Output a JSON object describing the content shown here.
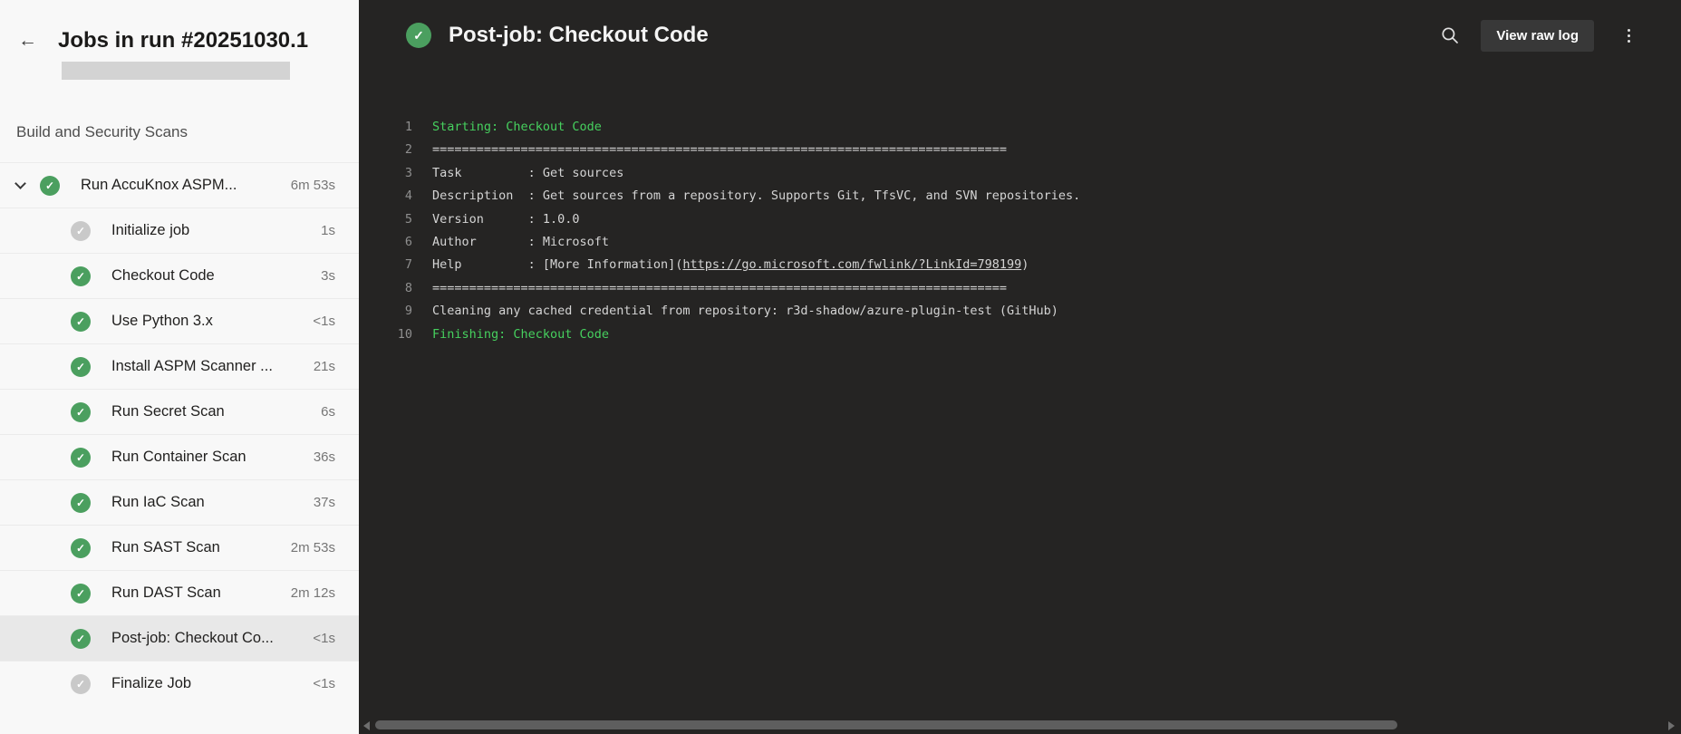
{
  "colors": {
    "success_green": "#4b9f5f",
    "pending_gray": "#c9c9c9",
    "panel_bg": "#252423",
    "log_green": "#46d05e",
    "log_text": "#d4d4d4",
    "line_num": "#8f8f8f",
    "sidebar_bg": "#f8f8f8",
    "selected_row": "#e8e8e8",
    "duration_gray": "#767676",
    "button_bg": "#383838"
  },
  "sidebar": {
    "back_icon": "left-arrow",
    "title": "Jobs in run #20251030.1",
    "section": "Build and Security Scans",
    "jobs": [
      {
        "label": "Run AccuKnox ASPM...",
        "duration": "6m 53s",
        "status": "success",
        "parent": true,
        "selected": false
      },
      {
        "label": "Initialize job",
        "duration": "1s",
        "status": "pending",
        "parent": false,
        "selected": false
      },
      {
        "label": "Checkout Code",
        "duration": "3s",
        "status": "success",
        "parent": false,
        "selected": false
      },
      {
        "label": "Use Python 3.x",
        "duration": "<1s",
        "status": "success",
        "parent": false,
        "selected": false
      },
      {
        "label": "Install ASPM Scanner ...",
        "duration": "21s",
        "status": "success",
        "parent": false,
        "selected": false
      },
      {
        "label": "Run Secret Scan",
        "duration": "6s",
        "status": "success",
        "parent": false,
        "selected": false
      },
      {
        "label": "Run Container Scan",
        "duration": "36s",
        "status": "success",
        "parent": false,
        "selected": false
      },
      {
        "label": "Run IaC Scan",
        "duration": "37s",
        "status": "success",
        "parent": false,
        "selected": false
      },
      {
        "label": "Run SAST Scan",
        "duration": "2m 53s",
        "status": "success",
        "parent": false,
        "selected": false
      },
      {
        "label": "Run DAST Scan",
        "duration": "2m 12s",
        "status": "success",
        "parent": false,
        "selected": false
      },
      {
        "label": "Post-job: Checkout Co...",
        "duration": "<1s",
        "status": "success",
        "parent": false,
        "selected": true
      },
      {
        "label": "Finalize Job",
        "duration": "<1s",
        "status": "pending",
        "parent": false,
        "selected": false
      }
    ]
  },
  "main": {
    "status": "success",
    "title": "Post-job: Checkout Code",
    "toolbar": {
      "search_icon": "magnifier",
      "view_raw_log_label": "View raw log",
      "more_icon": "kebab-vertical"
    },
    "log": {
      "lines": [
        {
          "num": "1",
          "segments": [
            {
              "text": "Starting: Checkout Code",
              "style": "section"
            }
          ]
        },
        {
          "num": "2",
          "segments": [
            {
              "text": "==============================================================================",
              "style": "plain"
            }
          ]
        },
        {
          "num": "3",
          "segments": [
            {
              "text": "Task         : Get sources",
              "style": "plain"
            }
          ]
        },
        {
          "num": "4",
          "segments": [
            {
              "text": "Description  : Get sources from a repository. Supports Git, TfsVC, and SVN repositories.",
              "style": "plain"
            }
          ]
        },
        {
          "num": "5",
          "segments": [
            {
              "text": "Version      : 1.0.0",
              "style": "plain"
            }
          ]
        },
        {
          "num": "6",
          "segments": [
            {
              "text": "Author       : Microsoft",
              "style": "plain"
            }
          ]
        },
        {
          "num": "7",
          "segments": [
            {
              "text": "Help         : [More Information](",
              "style": "plain"
            },
            {
              "text": "https://go.microsoft.com/fwlink/?LinkId=798199",
              "style": "link"
            },
            {
              "text": ")",
              "style": "plain"
            }
          ]
        },
        {
          "num": "8",
          "segments": [
            {
              "text": "==============================================================================",
              "style": "plain"
            }
          ]
        },
        {
          "num": "9",
          "segments": [
            {
              "text": "Cleaning any cached credential from repository: r3d-shadow/azure-plugin-test (GitHub)",
              "style": "plain"
            }
          ]
        },
        {
          "num": "10",
          "segments": [
            {
              "text": "Finishing: Checkout Code",
              "style": "section"
            }
          ]
        }
      ]
    },
    "scrollbar": {
      "orientation": "horizontal"
    }
  }
}
